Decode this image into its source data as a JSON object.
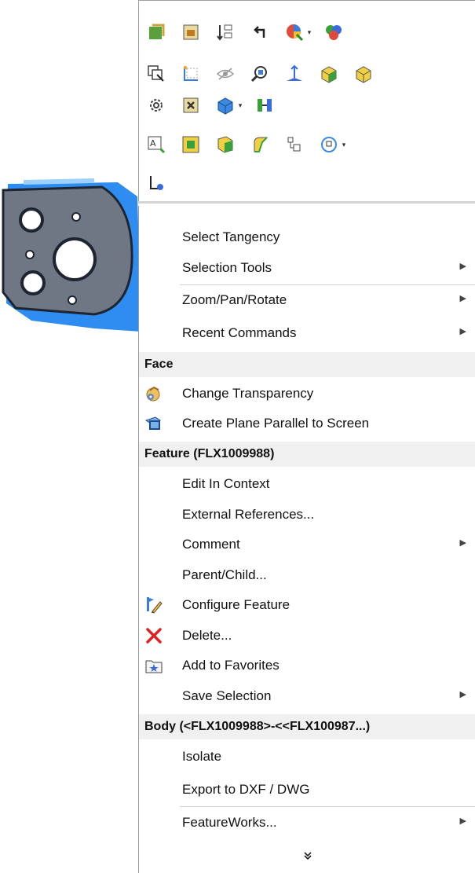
{
  "toolbar": {
    "icons": [
      [
        "rebuild-icon",
        "feature-icon",
        "sort-icon",
        "undo-arrow-icon",
        "appearance-icon",
        "dropdown-chevron-icon",
        "appearances-icon"
      ],
      [
        "select-other-icon",
        "sketch-icon",
        "hide-icon",
        "zoom-to-selection-icon",
        "normal-to-icon",
        "view-orientation-icon",
        "shaded-icon"
      ],
      [
        "options-icon",
        "suppress-icon",
        "display-state-icon",
        "dropdown-chevron-icon",
        "mate-icon"
      ],
      [
        "annotation-icon",
        "face-icon",
        "body-icon",
        "fillet-icon",
        "component-icon",
        "rotate-icon",
        "dropdown-chevron-icon"
      ],
      [
        "axis-view-icon"
      ]
    ],
    "chevron": "▾"
  },
  "menu": {
    "items_top": [
      {
        "label": "Select Tangency",
        "submenu": false
      },
      {
        "label": "Selection Tools",
        "submenu": true
      },
      {
        "label": "Zoom/Pan/Rotate",
        "submenu": true
      },
      {
        "label": "Recent Commands",
        "submenu": true
      }
    ],
    "face_header": "Face",
    "face_items": [
      {
        "label": "Change Transparency",
        "icon": "transparency-icon"
      },
      {
        "label": "Create Plane Parallel to Screen",
        "icon": "plane-icon"
      }
    ],
    "feature_header": "Feature (FLX1009988)",
    "feature_items": [
      {
        "label": "Edit In Context",
        "submenu": false
      },
      {
        "label": "External References...",
        "submenu": false
      },
      {
        "label": "Comment",
        "submenu": true
      },
      {
        "label": "Parent/Child...",
        "submenu": false
      },
      {
        "label": "Configure Feature",
        "icon": "configure-icon"
      },
      {
        "label": "Delete...",
        "icon": "delete-icon"
      },
      {
        "label": "Add to Favorites",
        "icon": "favorites-icon"
      },
      {
        "label": "Save Selection",
        "submenu": true
      }
    ],
    "body_header": "Body (<FLX1009988>-<<FLX100987...)",
    "body_items": [
      {
        "label": "Isolate",
        "submenu": false
      },
      {
        "label": "Export to DXF / DWG",
        "submenu": false
      },
      {
        "label": "FeatureWorks...",
        "submenu": true
      }
    ],
    "more_glyph": "⌄⌄",
    "submenu_arrow": "▶"
  },
  "colors": {
    "accent": "#2e8ae6",
    "delete": "#e02020",
    "header_bg": "#f0f0f0"
  }
}
